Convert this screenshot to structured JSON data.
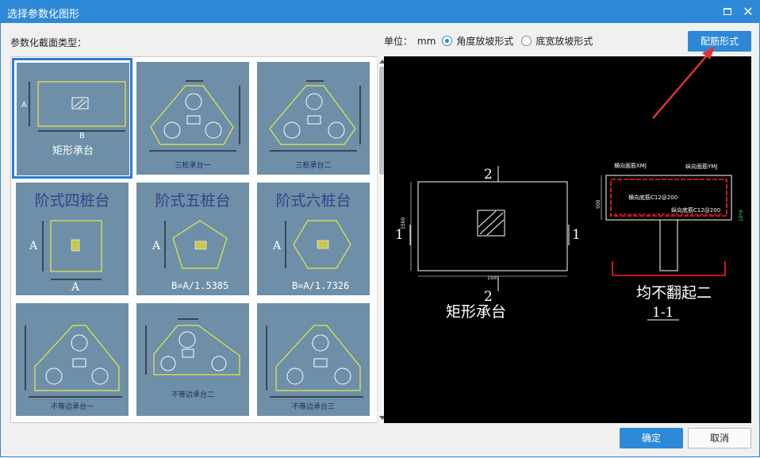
{
  "window": {
    "title": "选择参数化图形",
    "accent_color": "#2e88d8"
  },
  "section": {
    "type_label": "参数化截面类型："
  },
  "unit": {
    "label": "单位：",
    "value": "mm",
    "options": [
      "角度放坡形式",
      "底宽放坡形式"
    ],
    "selected": "角度放坡形式"
  },
  "actions": {
    "rebar_form": "配筋形式",
    "ok": "确定",
    "cancel": "取消"
  },
  "gallery": {
    "selected_index": 0,
    "items": [
      {
        "caption": "矩形承台",
        "dim_a": "A",
        "dim_b": "B"
      },
      {
        "caption": "三桩承台一"
      },
      {
        "caption": "三桩承台二"
      },
      {
        "caption": "阶式四桩台",
        "dim_a": "A",
        "dim_b": "A"
      },
      {
        "caption": "阶式五桩台",
        "dim_a": "A",
        "formula": "B=A/1.5385"
      },
      {
        "caption": "阶式六桩台",
        "dim_a": "A",
        "formula": "B=A/1.7326"
      },
      {
        "caption": "不等边承台一"
      },
      {
        "caption": "不等边承台二"
      },
      {
        "caption": "不等边承台三"
      }
    ]
  },
  "preview": {
    "plan_caption": "矩形承台",
    "plan_dim": "1500",
    "section_mark": "2",
    "side_mark": "1",
    "section_title": "均不翻起二",
    "section_name": "1-1",
    "rebar_labels": {
      "top_transverse": "横向面筋XMJ",
      "top_longitudinal": "纵向面筋YMJ",
      "bottom_transverse": "横向底筋C12@200",
      "bottom_longitudinal": "纵向底筋C12@200",
      "height": "500",
      "cover": "10*d"
    }
  }
}
